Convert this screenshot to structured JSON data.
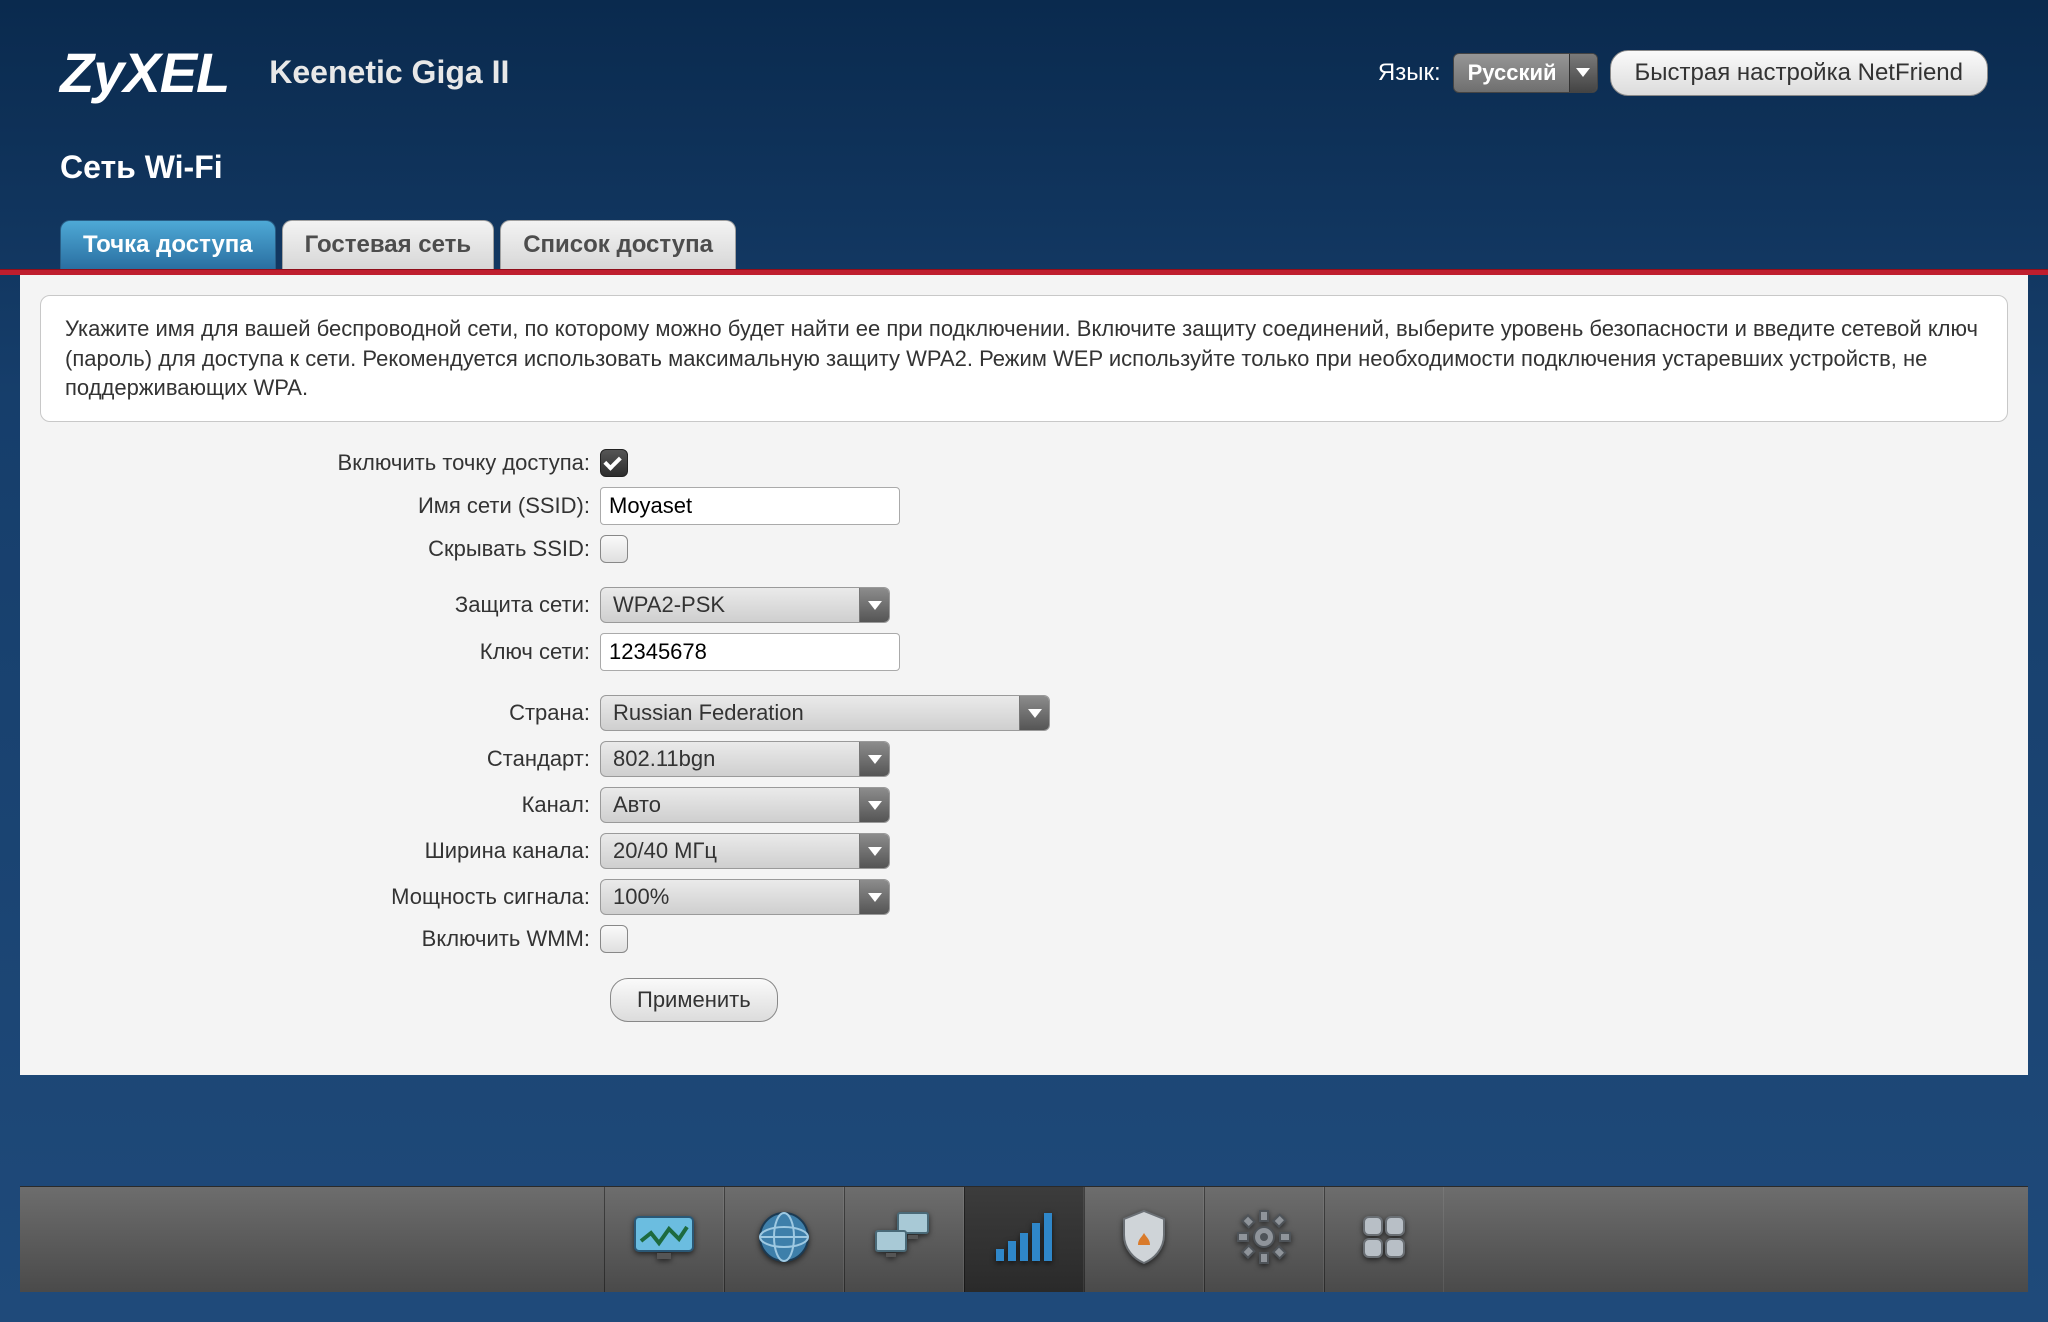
{
  "brand": "ZyXEL",
  "device": "Keenetic Giga II",
  "langLabel": "Язык:",
  "langValue": "Русский",
  "quickSetup": "Быстрая настройка NetFriend",
  "pageTitle": "Сеть Wi-Fi",
  "tabs": {
    "ap": "Точка доступа",
    "guest": "Гостевая сеть",
    "acl": "Список доступа"
  },
  "desc": "Укажите имя для вашей беспроводной сети, по которому можно будет найти ее при подключении. Включите защиту соединений, выберите уровень безопасности и введите сетевой ключ (пароль) для доступа к сети. Рекомендуется использовать максимальную защиту WPA2. Режим WEP используйте только при необходимости подключения устаревших устройств, не поддерживающих WPA.",
  "labels": {
    "enableAp": "Включить точку доступа:",
    "ssid": "Имя сети (SSID):",
    "hideSsid": "Скрывать SSID:",
    "security": "Защита сети:",
    "key": "Ключ сети:",
    "country": "Страна:",
    "standard": "Стандарт:",
    "channel": "Канал:",
    "width": "Ширина канала:",
    "power": "Мощность сигнала:",
    "wmm": "Включить WMM:"
  },
  "values": {
    "ssid": "Moyaset",
    "security": "WPA2-PSK",
    "key": "12345678",
    "country": "Russian Federation",
    "standard": "802.11bgn",
    "channel": "Авто",
    "width": "20/40 МГц",
    "power": "100%"
  },
  "apply": "Применить",
  "nav": {
    "monitor": "monitor",
    "internet": "internet",
    "network": "network",
    "wifi": "wifi",
    "security": "security",
    "system": "system",
    "apps": "apps"
  }
}
